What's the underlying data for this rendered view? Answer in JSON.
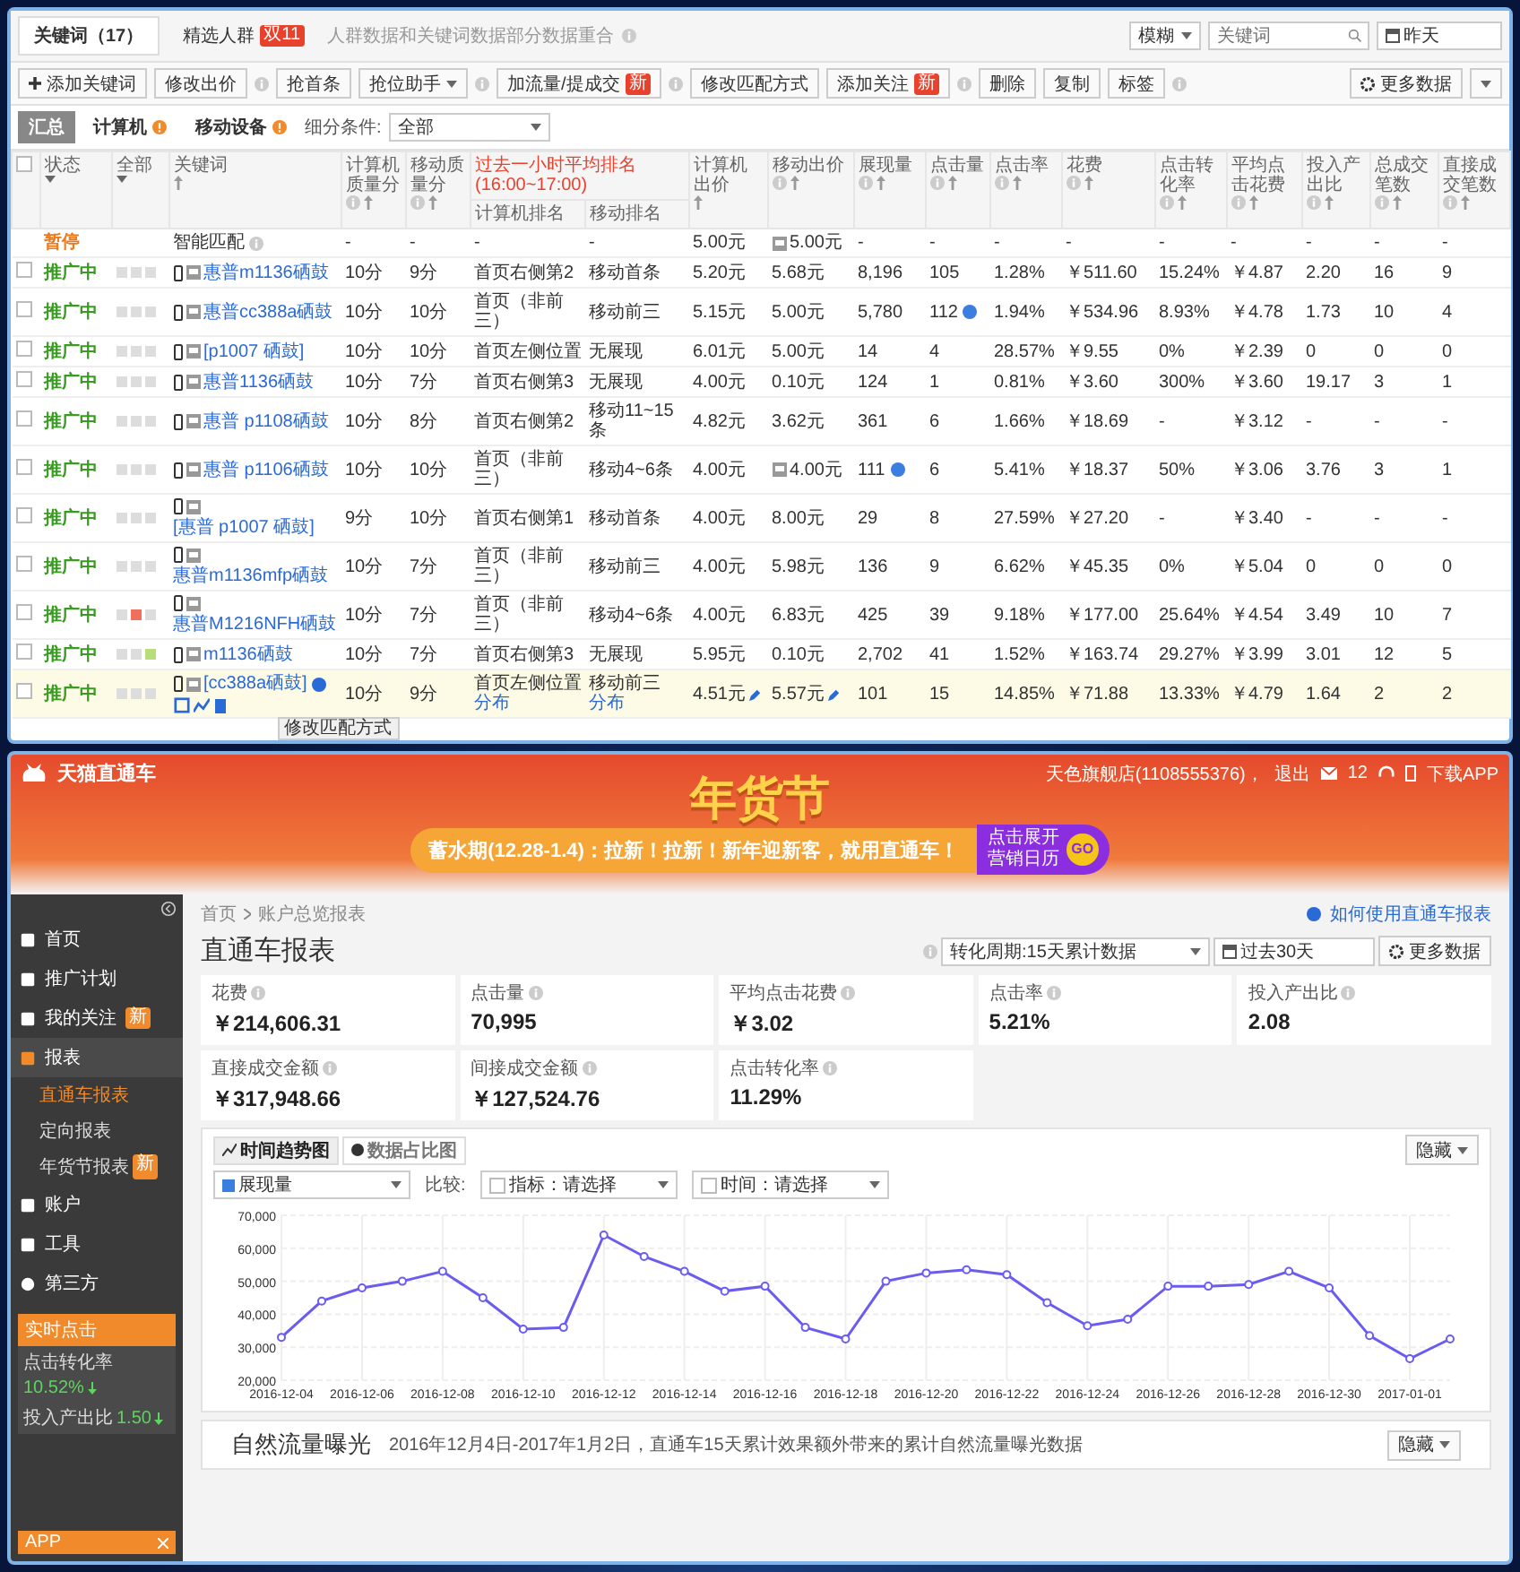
{
  "top": {
    "tabs": [
      {
        "label": "关键词（17）",
        "selected": true
      },
      {
        "label": "精选人群",
        "selected": false,
        "badge": "双11"
      }
    ],
    "tab_note": "人群数据和关键词数据部分数据重合",
    "match_select": "模糊",
    "search": {
      "placeholder": "关键词"
    },
    "date": "昨天",
    "toolbar": [
      {
        "label": "添加关键词",
        "kind": "add",
        "info": false
      },
      {
        "label": "修改出价",
        "kind": "button",
        "info": true
      },
      {
        "label": "抢首条",
        "kind": "button",
        "info": false
      },
      {
        "label": "抢位助手",
        "kind": "dropdown",
        "info": true
      },
      {
        "label": "加流量/提成交",
        "kind": "button",
        "badge": "新",
        "info": true
      },
      {
        "label": "修改匹配方式",
        "kind": "button",
        "info": false
      },
      {
        "label": "添加关注",
        "kind": "button",
        "badge": "新",
        "info": true
      },
      {
        "label": "删除",
        "kind": "button",
        "info": false
      },
      {
        "label": "复制",
        "kind": "button",
        "info": false
      },
      {
        "label": "标签",
        "kind": "button",
        "info": true
      }
    ],
    "more_data": "更多数据",
    "views": [
      {
        "label": "汇总",
        "selected": true,
        "alert": false
      },
      {
        "label": "计算机",
        "selected": false,
        "alert": true
      },
      {
        "label": "移动设备",
        "selected": false,
        "alert": true
      }
    ],
    "filter_label": "细分条件:",
    "filter_value": "全部"
  },
  "table": {
    "all_checked": false,
    "rank_group": "过去一小时平均排名(16:00~17:00)",
    "columns": [
      {
        "label": "状态",
        "menu": true,
        "info": false,
        "sort": false
      },
      {
        "label": "全部",
        "menu": true,
        "info": false,
        "sort": false
      },
      {
        "label": "关键词",
        "menu": false,
        "info": false,
        "sort": true
      },
      {
        "label": "计算机质量分",
        "menu": false,
        "info": true,
        "sort": true
      },
      {
        "label": "移动质量分",
        "menu": false,
        "info": true,
        "sort": true
      },
      {
        "label": "计算机排名",
        "menu": false,
        "info": false,
        "sort": false
      },
      {
        "label": "移动排名",
        "menu": false,
        "info": false,
        "sort": false
      },
      {
        "label": "计算机出价",
        "menu": false,
        "info": false,
        "sort": true
      },
      {
        "label": "移动出价",
        "menu": false,
        "info": true,
        "sort": true
      },
      {
        "label": "展现量",
        "menu": false,
        "info": true,
        "sort": true
      },
      {
        "label": "点击量",
        "menu": false,
        "info": true,
        "sort": true
      },
      {
        "label": "点击率",
        "menu": false,
        "info": true,
        "sort": true
      },
      {
        "label": "花费",
        "menu": false,
        "info": true,
        "sort": true
      },
      {
        "label": "点击转化率",
        "menu": false,
        "info": true,
        "sort": true
      },
      {
        "label": "平均点击花费",
        "menu": false,
        "info": true,
        "sort": true
      },
      {
        "label": "投入产出比",
        "menu": false,
        "info": true,
        "sort": true
      },
      {
        "label": "总成交笔数",
        "menu": false,
        "info": true,
        "sort": true
      },
      {
        "label": "直接成交笔数",
        "menu": false,
        "info": true,
        "sort": true
      }
    ],
    "rows": [
      {
        "kind": "smart",
        "paused": true,
        "selected": false,
        "mobile_bid_icon": true,
        "impressions_info": false,
        "clicks_info": false,
        "cells": [
          "暂停",
          "",
          "智能匹配",
          "-",
          "-",
          "-",
          "-",
          "5.00元",
          "5.00元",
          "-",
          "-",
          "-",
          "-",
          "-",
          "-",
          "-",
          "-",
          "-"
        ]
      },
      {
        "kind": "keyword",
        "checked": false,
        "selected": false,
        "paused": false,
        "squares": [
          {
            "color": "#dddddd"
          },
          {
            "color": "#dddddd"
          },
          {
            "color": "#dddddd"
          }
        ],
        "mobile_bid_icon": false,
        "impressions_info": false,
        "clicks_info": false,
        "cells": [
          "推广中",
          "",
          "惠普m1136硒鼓",
          "10分",
          "9分",
          "首页右侧第2",
          "移动首条",
          "5.20元",
          "5.68元",
          "8,196",
          "105",
          "1.28%",
          "￥511.60",
          "15.24%",
          "￥4.87",
          "2.20",
          "16",
          "9"
        ]
      },
      {
        "kind": "keyword",
        "checked": false,
        "selected": false,
        "paused": false,
        "squares": [
          {
            "color": "#dddddd"
          },
          {
            "color": "#dddddd"
          },
          {
            "color": "#dddddd"
          }
        ],
        "mobile_bid_icon": false,
        "impressions_info": false,
        "clicks_info": true,
        "cells": [
          "推广中",
          "",
          "惠普cc388a硒鼓",
          "10分",
          "10分",
          "首页（非前三）",
          "移动前三",
          "5.15元",
          "5.00元",
          "5,780",
          "112",
          "1.94%",
          "￥534.96",
          "8.93%",
          "￥4.78",
          "1.73",
          "10",
          "4"
        ]
      },
      {
        "kind": "keyword",
        "checked": false,
        "selected": false,
        "paused": false,
        "squares": [
          {
            "color": "#dddddd"
          },
          {
            "color": "#dddddd"
          },
          {
            "color": "#dddddd"
          }
        ],
        "mobile_bid_icon": false,
        "impressions_info": false,
        "clicks_info": false,
        "cells": [
          "推广中",
          "",
          "[p1007 硒鼓]",
          "10分",
          "10分",
          "首页左侧位置",
          "无展现",
          "6.01元",
          "5.00元",
          "14",
          "4",
          "28.57%",
          "￥9.55",
          "0%",
          "￥2.39",
          "0",
          "0",
          "0"
        ]
      },
      {
        "kind": "keyword",
        "checked": false,
        "selected": false,
        "paused": false,
        "squares": [
          {
            "color": "#dddddd"
          },
          {
            "color": "#dddddd"
          },
          {
            "color": "#dddddd"
          }
        ],
        "mobile_bid_icon": false,
        "impressions_info": false,
        "clicks_info": false,
        "cells": [
          "推广中",
          "",
          "惠普1136硒鼓",
          "10分",
          "7分",
          "首页右侧第3",
          "无展现",
          "4.00元",
          "0.10元",
          "124",
          "1",
          "0.81%",
          "￥3.60",
          "300%",
          "￥3.60",
          "19.17",
          "3",
          "1"
        ]
      },
      {
        "kind": "keyword",
        "checked": false,
        "selected": false,
        "paused": false,
        "squares": [
          {
            "color": "#dddddd"
          },
          {
            "color": "#dddddd"
          },
          {
            "color": "#dddddd"
          }
        ],
        "mobile_bid_icon": false,
        "impressions_info": false,
        "clicks_info": false,
        "cells": [
          "推广中",
          "",
          "惠普 p1108硒鼓",
          "10分",
          "8分",
          "首页右侧第2",
          "移动11~15条",
          "4.82元",
          "3.62元",
          "361",
          "6",
          "1.66%",
          "￥18.69",
          "-",
          "￥3.12",
          "-",
          "-",
          "-"
        ]
      },
      {
        "kind": "keyword",
        "checked": false,
        "selected": false,
        "paused": false,
        "squares": [
          {
            "color": "#dddddd"
          },
          {
            "color": "#dddddd"
          },
          {
            "color": "#dddddd"
          }
        ],
        "mobile_bid_icon": true,
        "impressions_info": true,
        "clicks_info": false,
        "cells": [
          "推广中",
          "",
          "惠普 p1106硒鼓",
          "10分",
          "10分",
          "首页（非前三）",
          "移动4~6条",
          "4.00元",
          "4.00元",
          "111",
          "6",
          "5.41%",
          "￥18.37",
          "50%",
          "￥3.06",
          "3.76",
          "3",
          "1"
        ]
      },
      {
        "kind": "keyword",
        "checked": false,
        "selected": false,
        "paused": false,
        "squares": [
          {
            "color": "#dddddd"
          },
          {
            "color": "#dddddd"
          },
          {
            "color": "#dddddd"
          }
        ],
        "mobile_bid_icon": false,
        "impressions_info": false,
        "clicks_info": false,
        "cells": [
          "推广中",
          "",
          "[惠普 p1007 硒鼓]",
          "9分",
          "10分",
          "首页右侧第1",
          "移动首条",
          "4.00元",
          "8.00元",
          "29",
          "8",
          "27.59%",
          "￥27.20",
          "-",
          "￥3.40",
          "-",
          "-",
          "-"
        ]
      },
      {
        "kind": "keyword",
        "checked": false,
        "selected": false,
        "paused": false,
        "squares": [
          {
            "color": "#dddddd"
          },
          {
            "color": "#dddddd"
          },
          {
            "color": "#dddddd"
          }
        ],
        "mobile_bid_icon": false,
        "impressions_info": false,
        "clicks_info": false,
        "cells": [
          "推广中",
          "",
          "惠普m1136mfp硒鼓",
          "10分",
          "7分",
          "首页（非前三）",
          "移动前三",
          "4.00元",
          "5.98元",
          "136",
          "9",
          "6.62%",
          "￥45.35",
          "0%",
          "￥5.04",
          "0",
          "0",
          "0"
        ]
      },
      {
        "kind": "keyword",
        "checked": false,
        "selected": false,
        "paused": false,
        "squares": [
          {
            "color": "#dddddd"
          },
          {
            "color": "#f07060"
          },
          {
            "color": "#dddddd"
          }
        ],
        "mobile_bid_icon": false,
        "impressions_info": false,
        "clicks_info": false,
        "cells": [
          "推广中",
          "",
          "惠普M1216NFH硒鼓",
          "10分",
          "7分",
          "首页（非前三）",
          "移动4~6条",
          "4.00元",
          "6.83元",
          "425",
          "39",
          "9.18%",
          "￥177.00",
          "25.64%",
          "￥4.54",
          "3.49",
          "10",
          "7"
        ]
      },
      {
        "kind": "keyword",
        "checked": false,
        "selected": false,
        "paused": false,
        "squares": [
          {
            "color": "#dddddd"
          },
          {
            "color": "#dddddd"
          },
          {
            "color": "#b8dd7a"
          }
        ],
        "mobile_bid_icon": false,
        "impressions_info": false,
        "clicks_info": false,
        "cells": [
          "推广中",
          "",
          "m1136硒鼓",
          "10分",
          "7分",
          "首页右侧第3",
          "无展现",
          "5.95元",
          "0.10元",
          "2,702",
          "41",
          "1.52%",
          "￥163.74",
          "29.27%",
          "￥3.99",
          "3.01",
          "12",
          "5"
        ]
      },
      {
        "kind": "keyword",
        "checked": false,
        "selected": true,
        "paused": false,
        "squares": [
          {
            "color": "#dddddd"
          },
          {
            "color": "#dddddd"
          },
          {
            "color": "#dddddd"
          }
        ],
        "tooltip": "修改匹配方式",
        "rank_links": [
          "分布",
          "分布"
        ],
        "mobile_bid_icon": false,
        "impressions_info": false,
        "clicks_info": false,
        "cells": [
          "推广中",
          "",
          "[cc388a硒鼓]",
          "10分",
          "9分",
          "首页左侧位置",
          "移动前三",
          "4.51元",
          "5.57元",
          "101",
          "15",
          "14.85%",
          "￥71.88",
          "13.33%",
          "￥4.79",
          "1.64",
          "2",
          "2"
        ]
      }
    ]
  },
  "header": {
    "logo": "天猫直通车",
    "account": "天色旗舰店(1108555376)，",
    "logout": "退出",
    "messages": "12",
    "download": "下载APP"
  },
  "banner": {
    "title": "年货节",
    "slogan": "蓄水期(12.28-1.4)：拉新！拉新！新年迎新客，就用直通车！",
    "cta": [
      "点击展开",
      "营销日历"
    ],
    "go": "GO"
  },
  "sidebar": {
    "items": [
      {
        "label": "首页",
        "selected": false
      },
      {
        "label": "推广计划",
        "selected": false
      },
      {
        "label": "我的关注",
        "selected": false,
        "badge": "新"
      },
      {
        "label": "报表",
        "selected": true,
        "children": [
          {
            "label": "直通车报表",
            "selected": true
          },
          {
            "label": "定向报表",
            "selected": false
          },
          {
            "label": "年货节报表",
            "selected": false,
            "badge": "新"
          }
        ]
      },
      {
        "label": "账户",
        "selected": false
      },
      {
        "label": "工具",
        "selected": false
      },
      {
        "label": "第三方",
        "selected": false
      }
    ],
    "realtime": {
      "title": "实时点击",
      "stats": [
        {
          "label": "点击转化率",
          "value": "10.52%"
        },
        {
          "label": "投入产出比",
          "value": "1.50"
        }
      ]
    },
    "app": "APP"
  },
  "report": {
    "breadcrumb": [
      "首页",
      "账户总览报表"
    ],
    "help": "如何使用直通车报表",
    "title": "直通车报表",
    "period": "转化周期:15天累计数据",
    "range": "过去30天",
    "more": "更多数据",
    "metrics": [
      {
        "label": "花费",
        "value": "￥214,606.31"
      },
      {
        "label": "点击量",
        "value": "70,995"
      },
      {
        "label": "平均点击花费",
        "value": "￥3.02"
      },
      {
        "label": "点击率",
        "value": "5.21%"
      },
      {
        "label": "投入产出比",
        "value": "2.08"
      },
      {
        "label": "直接成交金额",
        "value": "￥317,948.66"
      },
      {
        "label": "间接成交金额",
        "value": "￥127,524.76"
      },
      {
        "label": "点击转化率",
        "value": "11.29%"
      }
    ],
    "chart_tabs": [
      {
        "label": "时间趋势图",
        "selected": true
      },
      {
        "label": "数据占比图",
        "selected": false
      }
    ],
    "hide": "隐藏",
    "compare": "比较:",
    "index_select": "指标：请选择",
    "time_select": "时间：请选择",
    "chart_data": {
      "type": "line",
      "grid": true,
      "categories": [
        "2016-12-04",
        null,
        "2016-12-06",
        null,
        "2016-12-08",
        null,
        "2016-12-10",
        null,
        "2016-12-12",
        null,
        "2016-12-14",
        null,
        "2016-12-16",
        null,
        "2016-12-18",
        null,
        "2016-12-20",
        null,
        "2016-12-22",
        null,
        "2016-12-24",
        null,
        "2016-12-26",
        null,
        "2016-12-28",
        null,
        "2016-12-30",
        null,
        "2017-01-01",
        null
      ],
      "series": [
        {
          "name": "展现量",
          "color": "#6b5cf0",
          "marker": true,
          "values": [
            33000,
            44000,
            48000,
            50000,
            53000,
            45000,
            35500,
            36000,
            64000,
            57500,
            53000,
            47000,
            48500,
            36000,
            32500,
            50000,
            52500,
            53500,
            52000,
            43500,
            36500,
            38500,
            48500,
            48500,
            49000,
            53000,
            48000,
            33500,
            26500,
            32500
          ]
        }
      ],
      "ylim": [
        20000,
        70000
      ],
      "yticks": [
        {
          "value": 20000,
          "label": "20,000"
        },
        {
          "value": 30000,
          "label": "30,000"
        },
        {
          "value": 40000,
          "label": "40,000"
        },
        {
          "value": 50000,
          "label": "50,000"
        },
        {
          "value": 60000,
          "label": "60,000"
        },
        {
          "value": 70000,
          "label": "70,000"
        }
      ]
    },
    "natural": {
      "title": "自然流量曝光",
      "desc": "2016年12月4日-2017年1月2日，直通车15天累计效果额外带来的累计自然流量曝光数据",
      "hide": "隐藏"
    }
  }
}
